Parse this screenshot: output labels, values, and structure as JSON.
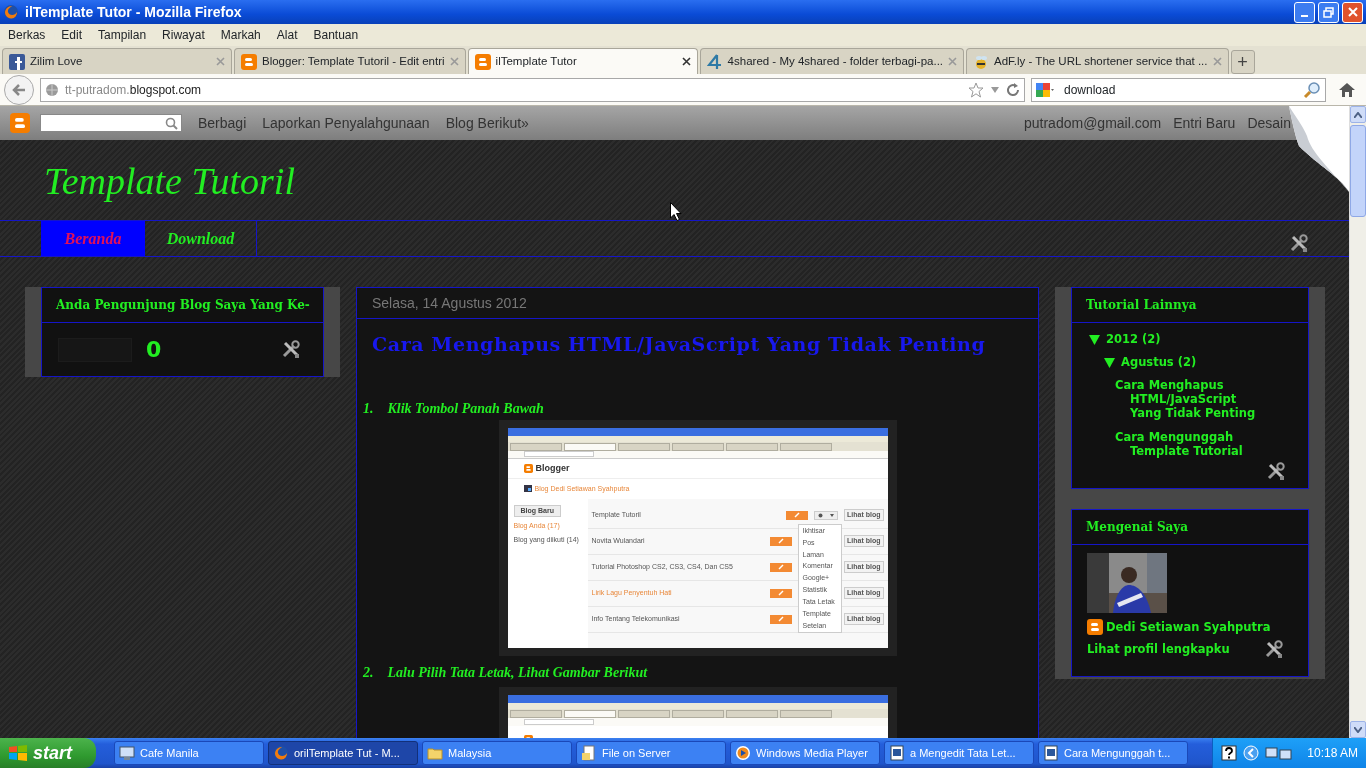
{
  "window": {
    "title": "ilTemplate Tutor - Mozilla Firefox"
  },
  "menu": [
    "Berkas",
    "Edit",
    "Tampilan",
    "Riwayat",
    "Markah",
    "Alat",
    "Bantuan"
  ],
  "tabs": [
    {
      "label": "Zilim Love",
      "selected": false
    },
    {
      "label": "Blogger: Template Tutoril - Edit entri",
      "selected": false
    },
    {
      "label": "ilTemplate Tutor",
      "selected": true
    },
    {
      "label": "4shared - My 4shared - folder terbagi-pa...",
      "selected": false
    },
    {
      "label": "AdF.ly - The URL shortener service that ...",
      "selected": false
    }
  ],
  "new_tab": "+",
  "address": {
    "prefix": "tt-putradom.",
    "domain": "blogspot.com"
  },
  "search": {
    "value": "download"
  },
  "blogger_bar": {
    "links": [
      "Berbagi",
      "Laporkan Penyalahgunaan",
      "Blog Berikut»"
    ],
    "right_links": [
      "putradom@gmail.com",
      "Entri Baru",
      "Desain"
    ]
  },
  "blog": {
    "title": "Template Tutoril",
    "pages": [
      {
        "label": "Beranda",
        "selected": true
      },
      {
        "label": "Download",
        "selected": false
      }
    ]
  },
  "counter_widget": {
    "title": "Anda Pengunjung Blog Saya Yang Ke-",
    "count": "0"
  },
  "post": {
    "date": "Selasa, 14 Agustus 2012",
    "title": "Cara Menghapus HTML/JavaScript Yang Tidak Penting",
    "steps": [
      {
        "number": "1.",
        "text": "Klik Tombol Panah Bawah"
      },
      {
        "number": "2.",
        "text": "Lalu Pilih Tata Letak, Lihat Gambar Berikut"
      }
    ],
    "screenshot": {
      "app_name": "Blogger",
      "blog_name": "Blog Dedi Setiawan Syahputra",
      "sidebar": [
        {
          "label": "Blog Baru",
          "kind": "button"
        },
        {
          "label": "Blog Anda (17)",
          "kind": "link"
        },
        {
          "label": "Blog yang diikuti (14)",
          "kind": "text"
        }
      ],
      "blogs": [
        {
          "title": "Template Tutoril",
          "highlighted": false,
          "action": "Lihat blog"
        },
        {
          "title": "Novita Wulandari",
          "highlighted": false,
          "action": "Lihat blog"
        },
        {
          "title": "Tutorial Photoshop CS2, CS3, CS4, Dan CS5",
          "highlighted": false,
          "action": "Lihat blog"
        },
        {
          "title": "Lirik Lagu Penyentuh Hati",
          "highlighted": true,
          "action": "Lihat blog"
        },
        {
          "title": "Info Tentang Telekomunikasi",
          "highlighted": false,
          "action": "Lihat blog"
        }
      ],
      "menu": [
        "Ikhtisar",
        "Pos",
        "Laman",
        "Komentar",
        "Google+",
        "Statistik",
        "Tata Letak",
        "Template",
        "Setelan"
      ]
    }
  },
  "archive": {
    "title": "Tutorial Lainnya",
    "children": [
      {
        "label": "2012 (2)",
        "expanded": true,
        "children": [
          {
            "label": "Agustus (2)",
            "expanded": true,
            "children": [
              {
                "label": "Cara Menghapus HTML/JavaScript Yang Tidak Penting"
              },
              {
                "label": "Cara Mengunggah Template Tutorial"
              }
            ]
          }
        ]
      }
    ]
  },
  "about": {
    "title": "Mengenai Saya",
    "name": "Dedi Setiawan Syahputra",
    "profile_link": "Lihat profil lengkapku"
  },
  "taskbar": {
    "start": "start",
    "items": [
      {
        "label": "Cafe Manila",
        "selected": false
      },
      {
        "label": "orilTemplate Tut - M...",
        "selected": true
      },
      {
        "label": "Malaysia",
        "selected": false
      },
      {
        "label": "File on Server",
        "selected": false
      },
      {
        "label": "Windows Media Player",
        "selected": false
      },
      {
        "label": "a Mengedit Tata Let...",
        "selected": false
      },
      {
        "label": "Cara Mengunggah t...",
        "selected": false
      }
    ],
    "clock": "10:18 AM"
  }
}
